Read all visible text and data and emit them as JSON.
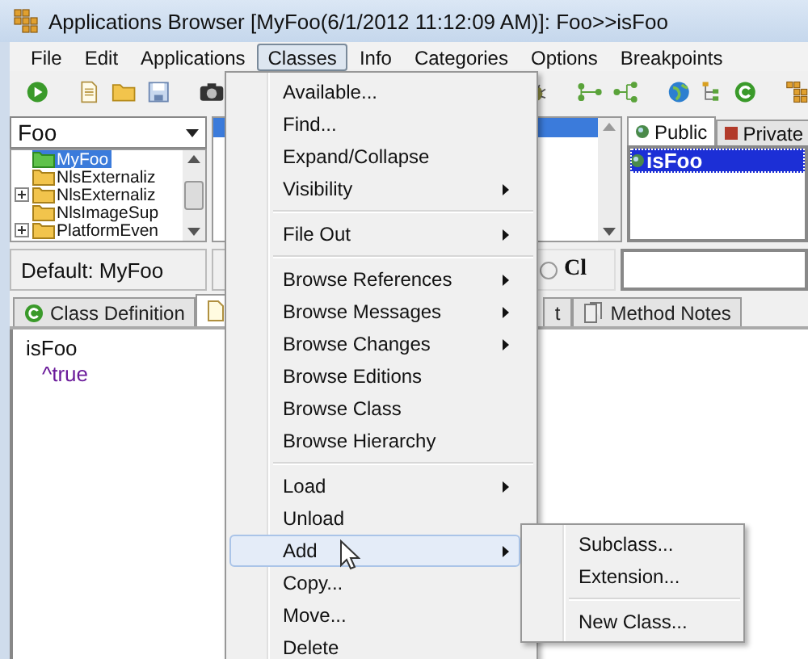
{
  "window": {
    "title": "Applications Browser [MyFoo(6/1/2012 11:12:09 AM)]: Foo>>isFoo"
  },
  "menubar": [
    {
      "label": "File",
      "selected": false
    },
    {
      "label": "Edit",
      "selected": false
    },
    {
      "label": "Applications",
      "selected": false
    },
    {
      "label": "Classes",
      "selected": true
    },
    {
      "label": "Info",
      "selected": false
    },
    {
      "label": "Categories",
      "selected": false
    },
    {
      "label": "Options",
      "selected": false
    },
    {
      "label": "Breakpoints",
      "selected": false
    }
  ],
  "app_selector": {
    "value": "Foo"
  },
  "app_list": [
    {
      "label": "MyFoo",
      "selected": true,
      "kind": "leaf"
    },
    {
      "label": "NlsExternaliz",
      "selected": false,
      "kind": "leaf"
    },
    {
      "label": "NlsExternaliz",
      "selected": false,
      "kind": "collapsed"
    },
    {
      "label": "NlsImageSup",
      "selected": false,
      "kind": "leaf"
    },
    {
      "label": "PlatformEven",
      "selected": false,
      "kind": "collapsed"
    }
  ],
  "category_list": [
    {
      "selected": true
    }
  ],
  "visibility_tabs": [
    {
      "label": "Public",
      "selected": true
    },
    {
      "label": "Private",
      "selected": false
    }
  ],
  "methods": [
    {
      "label": "isFoo",
      "selected": true
    }
  ],
  "default_label": "Default: MyFoo",
  "scope_radio": {
    "label": "Cl",
    "selected": false
  },
  "editor_tabs": [
    {
      "label": "Class Definition",
      "selected": false,
      "kind": "class"
    },
    {
      "selected": true,
      "kind": "doc"
    },
    {
      "label": "t",
      "selected": false,
      "kind": "plain"
    },
    {
      "label": "Method Notes",
      "selected": false,
      "kind": "notes"
    }
  ],
  "source": [
    {
      "text": "isFoo",
      "kind": "selector"
    },
    {
      "text": "^true",
      "kind": "statement"
    }
  ],
  "menu": [
    {
      "kind": "item",
      "label": "Available...",
      "submenu": false,
      "selected": false
    },
    {
      "kind": "item",
      "label": "Find...",
      "submenu": false,
      "selected": false
    },
    {
      "kind": "item",
      "label": "Expand/Collapse",
      "submenu": false,
      "selected": false
    },
    {
      "kind": "item",
      "label": "Visibility",
      "submenu": true,
      "selected": false
    },
    {
      "kind": "separator"
    },
    {
      "kind": "item",
      "label": "File Out",
      "submenu": true,
      "selected": false
    },
    {
      "kind": "separator"
    },
    {
      "kind": "item",
      "label": "Browse References",
      "submenu": true,
      "selected": false
    },
    {
      "kind": "item",
      "label": "Browse Messages",
      "submenu": true,
      "selected": false
    },
    {
      "kind": "item",
      "label": "Browse Changes",
      "submenu": true,
      "selected": false
    },
    {
      "kind": "item",
      "label": "Browse Editions",
      "submenu": false,
      "selected": false
    },
    {
      "kind": "item",
      "label": "Browse Class",
      "submenu": false,
      "selected": false
    },
    {
      "kind": "item",
      "label": "Browse Hierarchy",
      "submenu": false,
      "selected": false
    },
    {
      "kind": "separator"
    },
    {
      "kind": "item",
      "label": "Load",
      "submenu": true,
      "selected": false
    },
    {
      "kind": "item",
      "label": "Unload",
      "submenu": false,
      "selected": false
    },
    {
      "kind": "item",
      "label": "Add",
      "submenu": true,
      "selected": true
    },
    {
      "kind": "item",
      "label": "Copy...",
      "submenu": false,
      "selected": false
    },
    {
      "kind": "item",
      "label": "Move...",
      "submenu": false,
      "selected": false
    },
    {
      "kind": "item",
      "label": "Delete",
      "submenu": false,
      "selected": false
    }
  ],
  "submenu": [
    {
      "kind": "item",
      "label": "Subclass...",
      "selected": false
    },
    {
      "kind": "item",
      "label": "Extension...",
      "selected": false
    },
    {
      "kind": "separator"
    },
    {
      "kind": "item",
      "label": "New Class...",
      "selected": false
    }
  ]
}
